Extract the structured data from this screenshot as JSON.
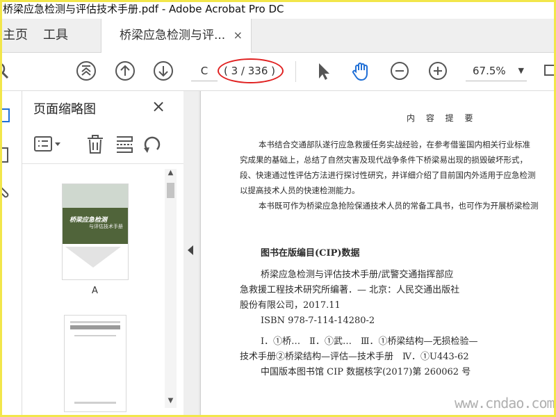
{
  "window": {
    "title": "桥梁应急检测与评估技术手册.pdf - Adobe Acrobat Pro DC"
  },
  "tabs": {
    "home": "主页",
    "tools": "工具",
    "document": "桥梁应急检测与评...",
    "close": "×"
  },
  "toolbar": {
    "page_input": "C",
    "page_count": "( 3 / 336 )",
    "zoom": "67.5%",
    "zoom_caret": "▼"
  },
  "thumbnails": {
    "panel_title": "页面缩略图",
    "close": "×",
    "thumb1_title": "桥梁应急检测",
    "thumb1_subtitle": "与评估技术手册",
    "thumb1_label": "A"
  },
  "document": {
    "heading": "内 容 提 要",
    "para1": [
      "　　本书结合交通部队遂行应急救援任务实战经验，在参考借鉴国内相关行业标准",
      "究成果的基础上，总结了自然灾害及现代战争条件下桥梁易出现的损毁破坏形式，",
      "段、快速通过性评估方法进行探讨性研究，并详细介绍了目前国内外适用于应急检测",
      "以提高技术人员的快速检测能力。"
    ],
    "para2": "　　本书既可作为桥梁应急抢险保通技术人员的常备工具书，也可作为开展桥梁检测",
    "cip_title": "图书在版编目(CIP)数据",
    "cip_lines": [
      "　　桥梁应急检测与评估技术手册/武警交通指挥部应",
      "急救援工程技术研究所编著．— 北京：人民交通出版社",
      "股份有限公司，2017.11",
      "　　ISBN 978-7-114-14280-2",
      "",
      "　　Ⅰ．①桥…　Ⅱ．①武…　Ⅲ．①桥梁结构—无损检验—",
      "技术手册②桥梁结构—评估—技术手册　Ⅳ．①U443-62",
      "　　中国版本图书馆 CIP 数据核字(2017)第 260062 号"
    ]
  },
  "watermark": "www.cndao.com",
  "colors": {
    "highlight_ellipse": "#e02020",
    "frame": "#f2e64a",
    "hand_tool": "#1f6fd6",
    "cover_band": "#50643a"
  }
}
